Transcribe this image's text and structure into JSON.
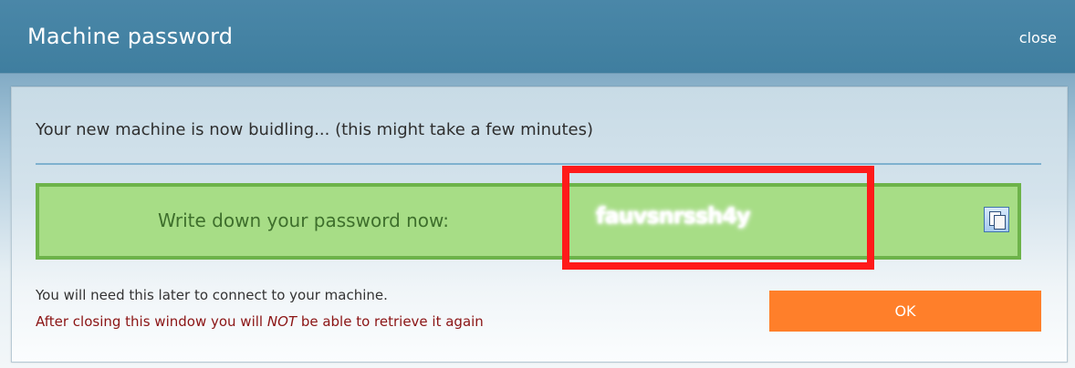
{
  "dialog": {
    "title": "Machine password",
    "close_label": "close"
  },
  "content": {
    "message": "Your new machine is now buidling... (this might take a few minutes)",
    "password_label": "Write down your password now:",
    "password_value": "fauvsnrssh4y",
    "note": "You will need this later to connect to your machine.",
    "warning_prefix": "After closing this window you will ",
    "warning_emphasis": "NOT",
    "warning_suffix": " be able to retrieve it again",
    "ok_label": "OK"
  },
  "icons": {
    "copy": "copy-icon"
  },
  "colors": {
    "titlebar": "#3f7e9f",
    "password_box": "#a7dd86",
    "password_border": "#6db34a",
    "highlight_box": "#ff1a1a",
    "ok_button": "#ff7f2a",
    "warning_text": "#8b1414"
  }
}
